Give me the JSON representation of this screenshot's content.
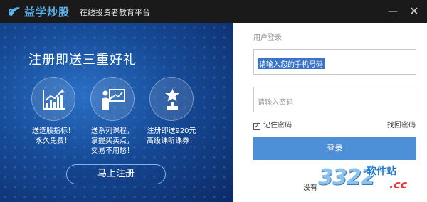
{
  "titlebar": {
    "brand": "益学炒股",
    "subtitle": "在线投资者教育平台",
    "minimize_glyph": "—",
    "close_glyph": "✕"
  },
  "promo": {
    "title": "注册即送三重好礼",
    "features": [
      {
        "icon": "chart-trend-icon",
        "lines": [
          "送选股指标！",
          "永久免费！"
        ]
      },
      {
        "icon": "teacher-board-icon",
        "lines": [
          "送系列课程，",
          "掌握买卖点，",
          "交易不用愁！"
        ]
      },
      {
        "icon": "trophy-star-icon",
        "lines": [
          "注册即送920元",
          "高级课听课券！"
        ]
      }
    ],
    "register_button": "马上注册"
  },
  "login": {
    "title": "用户登录",
    "phone_value": "请输入您的手机号码",
    "password_placeholder": "请输入密码",
    "remember_label": "记住密码",
    "remember_checked": true,
    "checkbox_mark": "✓",
    "forgot_label": "找回密码",
    "login_button": "登录",
    "no_account_text": "没有"
  },
  "watermark": {
    "number": "3322",
    "site": "软件站",
    "domain": ".cc"
  },
  "colors": {
    "titlebar": "#1a1a1a",
    "brand": "#5ab4f0",
    "promo_bg": "#164a96",
    "login_button": "#4d90d8",
    "selection": "#3a73c8"
  }
}
